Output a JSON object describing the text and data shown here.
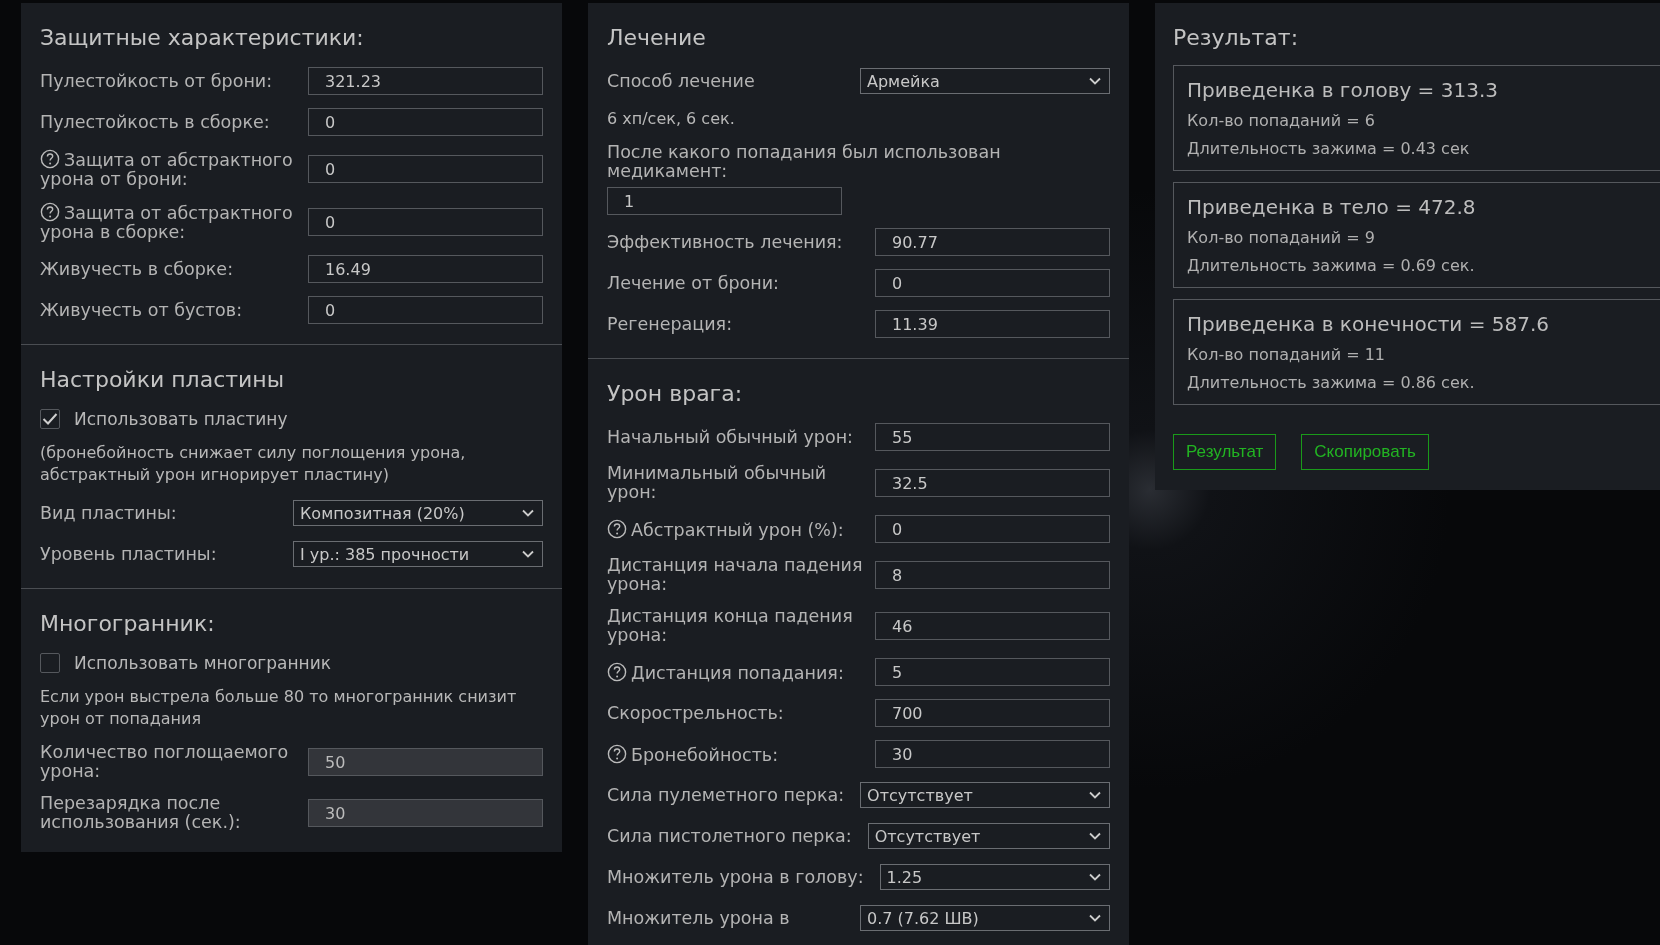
{
  "columns": [
    {
      "sections": [
        {
          "title": "Защитные характеристики:",
          "rows": [
            {
              "kind": "input",
              "label": "Пулестойкость от брони:",
              "value": "321.23",
              "help": false,
              "disabled": false
            },
            {
              "kind": "input",
              "label": "Пулестойкость в сборке:",
              "value": "0",
              "help": false,
              "disabled": false
            },
            {
              "kind": "input",
              "label": "Защита от абстрактного урона от брони:",
              "value": "0",
              "help": true,
              "disabled": false
            },
            {
              "kind": "input",
              "label": "Защита от абстрактного урона в сборке:",
              "value": "0",
              "help": true,
              "disabled": false
            },
            {
              "kind": "input",
              "label": "Живучесть в сборке:",
              "value": "16.49",
              "help": false,
              "disabled": false
            },
            {
              "kind": "input",
              "label": "Живучесть от бустов:",
              "value": "0",
              "help": false,
              "disabled": false
            }
          ]
        },
        {
          "title": "Настройки пластины",
          "rows": [
            {
              "kind": "checkbox",
              "label": "Использовать пластину",
              "checked": true
            },
            {
              "kind": "note",
              "text": "(бронебойность снижает силу поглощения урона, абстрактный урон игнорирует пластину)"
            },
            {
              "kind": "select",
              "label": "Вид пластины:",
              "value": "Композитная (20%)"
            },
            {
              "kind": "select",
              "label": "Уровень пластины:",
              "value": "I ур.: 385 прочности"
            }
          ]
        },
        {
          "title": "Многогранник:",
          "rows": [
            {
              "kind": "checkbox",
              "label": "Использовать многогранник",
              "checked": false
            },
            {
              "kind": "note",
              "text": "Если урон выстрела больше 80 то многогранник снизит урон от попадания"
            },
            {
              "kind": "input",
              "label": "Количество поглощаемого урона:",
              "value": "50",
              "help": false,
              "disabled": true
            },
            {
              "kind": "input",
              "label": "Перезарядка после использования (сек.):",
              "value": "30",
              "help": false,
              "disabled": true
            }
          ]
        }
      ]
    },
    {
      "sections": [
        {
          "title": "Лечение",
          "rows": [
            {
              "kind": "select",
              "label": "Способ лечение",
              "value": "Армейка"
            },
            {
              "kind": "note",
              "text": "6 хп/сек, 6 сек."
            },
            {
              "kind": "stacked",
              "label": "После какого попадания был использован медикамент:",
              "value": "1"
            },
            {
              "kind": "input",
              "label": "Эффективность лечения:",
              "value": "90.77",
              "help": false,
              "disabled": false
            },
            {
              "kind": "input",
              "label": "Лечение от брони:",
              "value": "0",
              "help": false,
              "disabled": false
            },
            {
              "kind": "input",
              "label": "Регенерация:",
              "value": "11.39",
              "help": false,
              "disabled": false
            }
          ]
        },
        {
          "title": "Урон врага:",
          "rows": [
            {
              "kind": "input",
              "label": "Начальный обычный урон:",
              "value": "55",
              "help": false,
              "disabled": false
            },
            {
              "kind": "input",
              "label": "Минимальный обычный урон:",
              "value": "32.5",
              "help": false,
              "disabled": false
            },
            {
              "kind": "input",
              "label": "Абстрактный урон (%):",
              "value": "0",
              "help": true,
              "disabled": false
            },
            {
              "kind": "input",
              "label": "Дистанция начала падения урона:",
              "value": "8",
              "help": false,
              "disabled": false
            },
            {
              "kind": "input",
              "label": "Дистанция конца падения урона:",
              "value": "46",
              "help": false,
              "disabled": false
            },
            {
              "kind": "input",
              "label": "Дистанция попадания:",
              "value": "5",
              "help": true,
              "disabled": false
            },
            {
              "kind": "input",
              "label": "Скорострельность:",
              "value": "700",
              "help": false,
              "disabled": false
            },
            {
              "kind": "input",
              "label": "Бронебойность:",
              "value": "30",
              "help": true,
              "disabled": false
            },
            {
              "kind": "select",
              "label": "Сила пулеметного перка:",
              "value": "Отсутствует"
            },
            {
              "kind": "select",
              "label": "Сила пистолетного перка:",
              "value": "Отсутствует"
            },
            {
              "kind": "select",
              "label": "Множитель урона в голову:",
              "value": "1.25"
            },
            {
              "kind": "select",
              "label": "Множитель урона в",
              "value": "0.7 (7.62 ШВ)"
            }
          ]
        }
      ]
    }
  ],
  "result": {
    "title": "Результат:",
    "cards": [
      {
        "heading": "Приведенка в голову = 313.3",
        "lines": [
          "Кол-во попаданий = 6",
          "Длительность зажима = 0.43 сек"
        ]
      },
      {
        "heading": "Приведенка в тело = 472.8",
        "lines": [
          "Кол-во попаданий = 9",
          "Длительность зажима = 0.69 сек."
        ]
      },
      {
        "heading": "Приведенка в конечности = 587.6",
        "lines": [
          "Кол-во попаданий = 11",
          "Длительность зажима = 0.86 сек."
        ]
      }
    ],
    "buttons": [
      "Результат",
      "Скопировать"
    ]
  }
}
